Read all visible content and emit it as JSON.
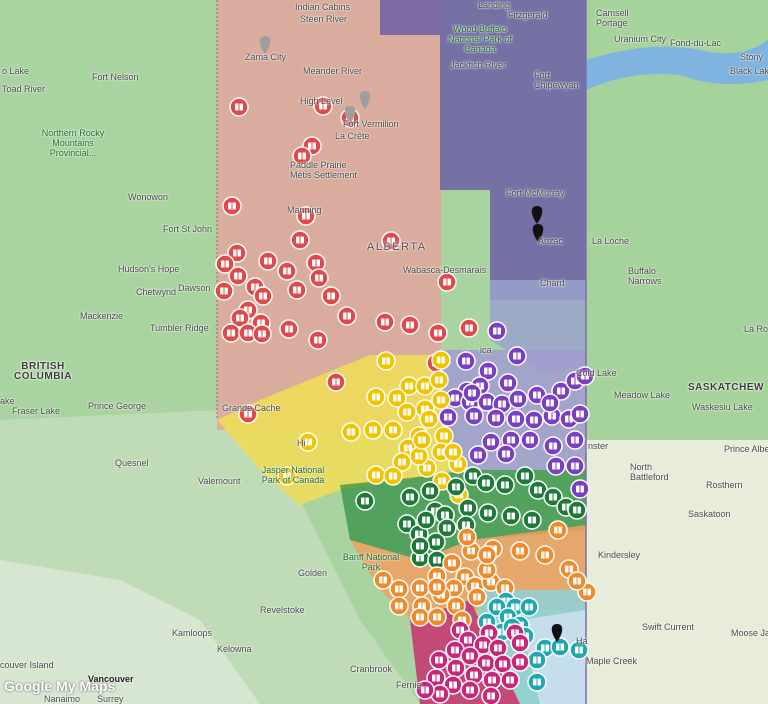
{
  "map": {
    "watermark": "Google My Maps",
    "colors": {
      "north": "#e8a09a",
      "northeast": "#7b6fb0",
      "east": "#8f99c4",
      "central": "#f0e060",
      "calgary": "#2e8b3e",
      "south": "#f0a060",
      "southeast": "#3ab0b0",
      "southwest": "#d0306a",
      "pin_north": "#e04a4a",
      "pin_ne": "#111111",
      "pin_east": "#7b3fc4",
      "pin_central": "#f2c400",
      "pin_calgary": "#1f7a3a",
      "pin_south": "#f08a2a",
      "pin_se": "#20a8b0",
      "pin_sw": "#c8287a"
    },
    "labels": {
      "steen_river": "Steen River",
      "indian_cabins": "Indian Cabins",
      "zama_city": "Zama City",
      "meander_river": "Meander River",
      "high_level": "High Level",
      "fort_vermilion": "Fort Vermilion",
      "la_crete": "La Crête",
      "paddle_metis": "Paddle Prairie Métis Settlement",
      "wood_buffalo": "Wood Buffalo National Park of Canada",
      "jackfish": "Jackfish River",
      "fitzgerald": "Fitzgerald",
      "landing": "Landing",
      "fort_chipewyan": "Fort Chipewyan",
      "fort_mcmurray": "Fort McMurray",
      "anzac": "Anzac",
      "chard": "Chard",
      "la_loche": "La Loche",
      "buffalo_narrows": "Buffalo Narrows",
      "la_ronge": "La Ronge",
      "camsell_portage": "Camsell Portage",
      "uranium_city": "Uranium City",
      "fond_du_lac": "Fond-du-Lac",
      "stony": "Stony",
      "black_lake": "Black Lake",
      "fort_nelson": "Fort Nelson",
      "toad_river": "Toad River",
      "o_lake": "o Lake",
      "northern_rocky": "Northern Rocky Mountains Provincial...",
      "wonowon": "Wonowon",
      "fort_st_john": "Fort St John",
      "hudsons_hope": "Hudson's Hope",
      "chetwynd": "Chetwynd",
      "dawson": "Dawson",
      "mackenzie": "Mackenzie",
      "tumbler_ridge": "Tumbler Ridge",
      "bc": "BRITISH COLUMBIA",
      "fraser_lake": "Fraser Lake",
      "prince_george": "Prince George",
      "quesnel": "Quesnel",
      "valemount": "Valemount",
      "jasper": "Jasper National Park of Canada",
      "alberta": "ALBERTA",
      "wabasca": "Wabasca-Desmarais",
      "manning": "Manning",
      "grande_cache": "Grande Cache",
      "golden": "Golden",
      "banff": "Banff National Park",
      "revelstoke": "Revelstoke",
      "kamloops": "Kamloops",
      "kelowna": "Kelowna",
      "vancouver": "Vancouver",
      "surrey": "Surrey",
      "nanaimo": "Nanaimo",
      "couver_island": "couver Island",
      "cranbrook": "Cranbrook",
      "fernie": "Fernie",
      "saskatchewan": "SASKATCHEW",
      "meadow_lake": "Meadow Lake",
      "waskesiu": "Waskesiu Lake",
      "cold_lake": "Cold Lake",
      "lloydminster": "nster",
      "north_battleford": "North Battleford",
      "prince_albert": "Prince Albe",
      "rosthern": "Rosthern",
      "saskatoon": "Saskatoon",
      "kindersley": "Kindersley",
      "swift_current": "Swift Current",
      "moose_jaw": "Moose Ja",
      "maple_creek": "Maple Creek",
      "ha": "Ha",
      "ica": "ica",
      "ake": "ake",
      "hi": "Hi"
    }
  }
}
